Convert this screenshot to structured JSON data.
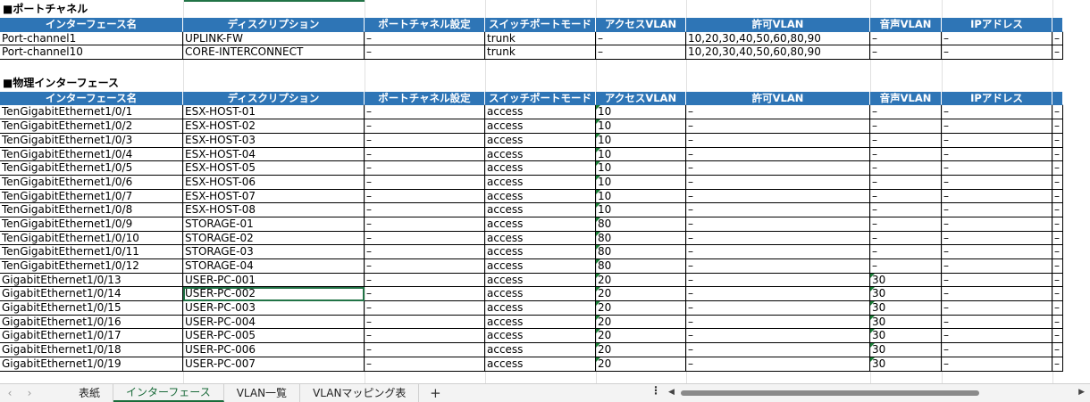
{
  "sections": {
    "port_channel": {
      "title": "■ポートチャネル",
      "rows": [
        [
          "Port-channel1",
          "UPLINK-FW",
          "–",
          "trunk",
          "–",
          "10,20,30,40,50,60,80,90",
          "–",
          "–",
          "–"
        ],
        [
          "Port-channel10",
          "CORE-INTERCONNECT",
          "–",
          "trunk",
          "–",
          "10,20,30,40,50,60,80,90",
          "–",
          "–",
          "–"
        ]
      ]
    },
    "physical": {
      "title": "■物理インターフェース",
      "rows": [
        [
          "TenGigabitEthernet1/0/1",
          "ESX-HOST-01",
          "–",
          "access",
          "10",
          "–",
          "–",
          "–",
          "–"
        ],
        [
          "TenGigabitEthernet1/0/2",
          "ESX-HOST-02",
          "–",
          "access",
          "10",
          "–",
          "–",
          "–",
          "–"
        ],
        [
          "TenGigabitEthernet1/0/3",
          "ESX-HOST-03",
          "–",
          "access",
          "10",
          "–",
          "–",
          "–",
          "–"
        ],
        [
          "TenGigabitEthernet1/0/4",
          "ESX-HOST-04",
          "–",
          "access",
          "10",
          "–",
          "–",
          "–",
          "–"
        ],
        [
          "TenGigabitEthernet1/0/5",
          "ESX-HOST-05",
          "–",
          "access",
          "10",
          "–",
          "–",
          "–",
          "–"
        ],
        [
          "TenGigabitEthernet1/0/6",
          "ESX-HOST-06",
          "–",
          "access",
          "10",
          "–",
          "–",
          "–",
          "–"
        ],
        [
          "TenGigabitEthernet1/0/7",
          "ESX-HOST-07",
          "–",
          "access",
          "10",
          "–",
          "–",
          "–",
          "–"
        ],
        [
          "TenGigabitEthernet1/0/8",
          "ESX-HOST-08",
          "–",
          "access",
          "10",
          "–",
          "–",
          "–",
          "–"
        ],
        [
          "TenGigabitEthernet1/0/9",
          "STORAGE-01",
          "–",
          "access",
          "80",
          "–",
          "–",
          "–",
          "–"
        ],
        [
          "TenGigabitEthernet1/0/10",
          "STORAGE-02",
          "–",
          "access",
          "80",
          "–",
          "–",
          "–",
          "–"
        ],
        [
          "TenGigabitEthernet1/0/11",
          "STORAGE-03",
          "–",
          "access",
          "80",
          "–",
          "–",
          "–",
          "–"
        ],
        [
          "TenGigabitEthernet1/0/12",
          "STORAGE-04",
          "–",
          "access",
          "80",
          "–",
          "–",
          "–",
          "–"
        ],
        [
          "GigabitEthernet1/0/13",
          "USER-PC-001",
          "–",
          "access",
          "20",
          "–",
          "30",
          "–",
          "–"
        ],
        [
          "GigabitEthernet1/0/14",
          "USER-PC-002",
          "–",
          "access",
          "20",
          "–",
          "30",
          "–",
          "–"
        ],
        [
          "GigabitEthernet1/0/15",
          "USER-PC-003",
          "–",
          "access",
          "20",
          "–",
          "30",
          "–",
          "–"
        ],
        [
          "GigabitEthernet1/0/16",
          "USER-PC-004",
          "–",
          "access",
          "20",
          "–",
          "30",
          "–",
          "–"
        ],
        [
          "GigabitEthernet1/0/17",
          "USER-PC-005",
          "–",
          "access",
          "20",
          "–",
          "30",
          "–",
          "–"
        ],
        [
          "GigabitEthernet1/0/18",
          "USER-PC-006",
          "–",
          "access",
          "20",
          "–",
          "30",
          "–",
          "–"
        ],
        [
          "GigabitEthernet1/0/19",
          "USER-PC-007",
          "–",
          "access",
          "20",
          "–",
          "30",
          "–",
          "–"
        ]
      ]
    }
  },
  "headers": [
    "インターフェース名",
    "ディスクリプション",
    "ポートチャネル設定",
    "スイッチポートモード",
    "アクセスVLAN",
    "許可VLAN",
    "音声VLAN",
    "IPアドレス",
    ""
  ],
  "tabs": [
    "表紙",
    "インターフェース",
    "VLAN一覧",
    "VLANマッピング表"
  ],
  "active_tab_index": 1,
  "nav": {
    "prev": "‹",
    "next": "›",
    "add": "+",
    "more": "⋮"
  },
  "colors": {
    "header_bg": "#2e75b6",
    "active_tab": "#1a6b3a",
    "selection": "#217346",
    "error_marker": "#1a7f37"
  }
}
